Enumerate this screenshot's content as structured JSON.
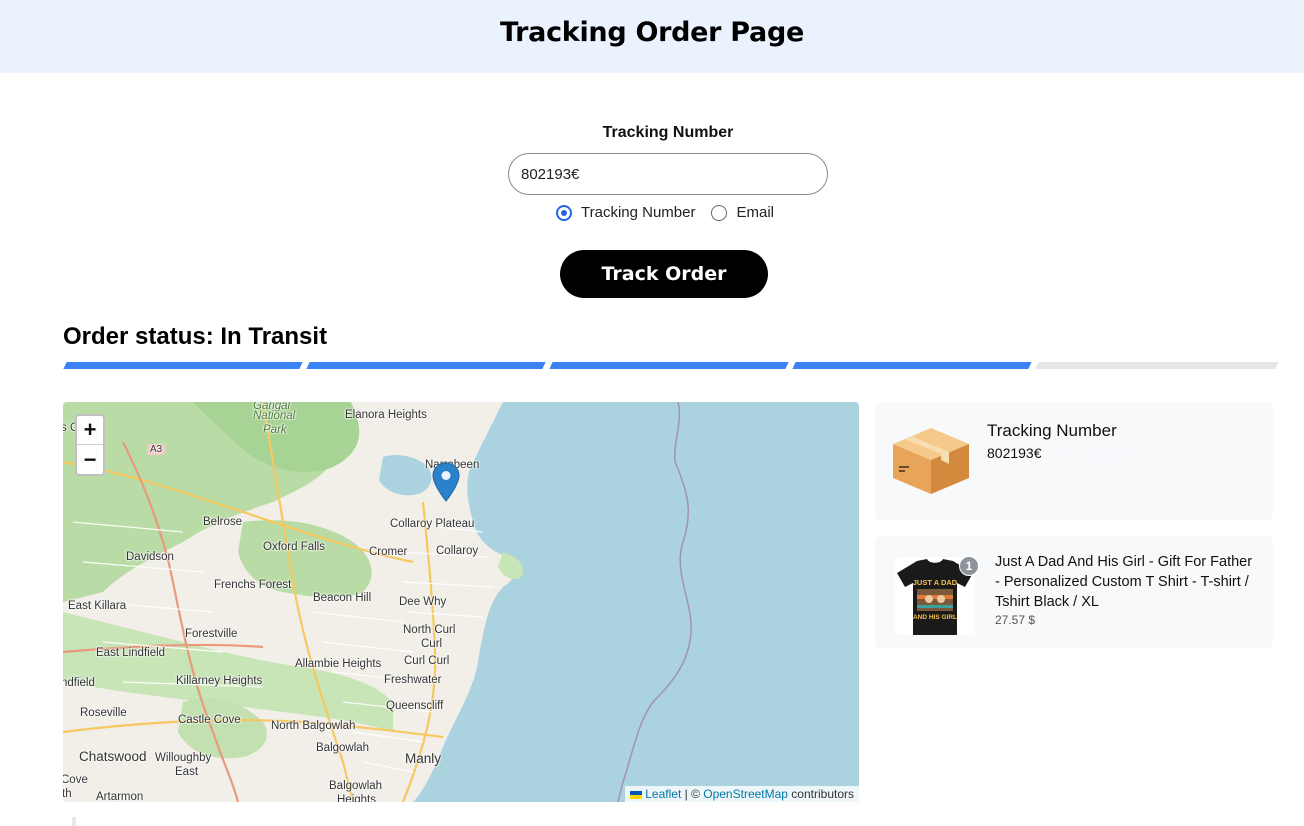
{
  "header": {
    "title": "Tracking Order Page"
  },
  "form": {
    "label": "Tracking Number",
    "input_value": "802193€",
    "radio_options": [
      {
        "label": "Tracking Number",
        "checked": true
      },
      {
        "label": "Email",
        "checked": false
      }
    ],
    "submit_label": "Track Order"
  },
  "status": {
    "text": "Order status: In Transit",
    "steps_total": 5,
    "steps_completed": 4,
    "progress_color": "#3b82f6"
  },
  "map": {
    "zoom_in": "+",
    "zoom_out": "−",
    "attribution": {
      "leaflet": "Leaflet",
      "separator": " | © ",
      "osm": "OpenStreetMap",
      "suffix": " contributors"
    },
    "labels": {
      "garigal": "Garigal",
      "national": "National",
      "park": "Park",
      "elanora_heights": "Elanora Heights",
      "a3": "A3",
      "narrabeen": "Narrabeen",
      "belrose": "Belrose",
      "collaroy_plateau": "Collaroy Plateau",
      "davidson": "Davidson",
      "oxford_falls": "Oxford Falls",
      "cromer": "Cromer",
      "collaroy": "Collaroy",
      "frenchs_forest": "Frenchs Forest",
      "east_killara": "East Killara",
      "beacon_hill": "Beacon Hill",
      "dee_why": "Dee Why",
      "forestville": "Forestville",
      "north_curl_curl_1": "North Curl",
      "north_curl_curl_2": "Curl",
      "east_lindfield": "East Lindfield",
      "allambie_heights": "Allambie Heights",
      "curl_curl": "Curl Curl",
      "killarney_heights": "Killarney Heights",
      "freshwater": "Freshwater",
      "ndfield": "ndfield",
      "roseville": "Roseville",
      "queenscliff": "Queenscliff",
      "castle_cove": "Castle Cove",
      "north_balgowlah": "North Balgowlah",
      "balgowlah": "Balgowlah",
      "chatswood": "Chatswood",
      "willoughby": "Willoughby",
      "willoughby_east": "East",
      "manly": "Manly",
      "cove": "Cove",
      "th": "th",
      "artarmon": "Artarmon",
      "balgowlah_heights_1": "Balgowlah",
      "balgowlah_heights_2": "Heights",
      "s_g": "s G"
    }
  },
  "tracking_card": {
    "label": "Tracking Number",
    "value": "802193€"
  },
  "product_card": {
    "quantity": "1",
    "name": "Just A Dad And His Girl - Gift For Father - Personalized Custom T Shirt - T-shirt / Tshirt Black / XL",
    "price": "27.57 $",
    "shirt_text_top": "JUST A DAD",
    "shirt_text_bottom": "AND HIS GIRL"
  }
}
